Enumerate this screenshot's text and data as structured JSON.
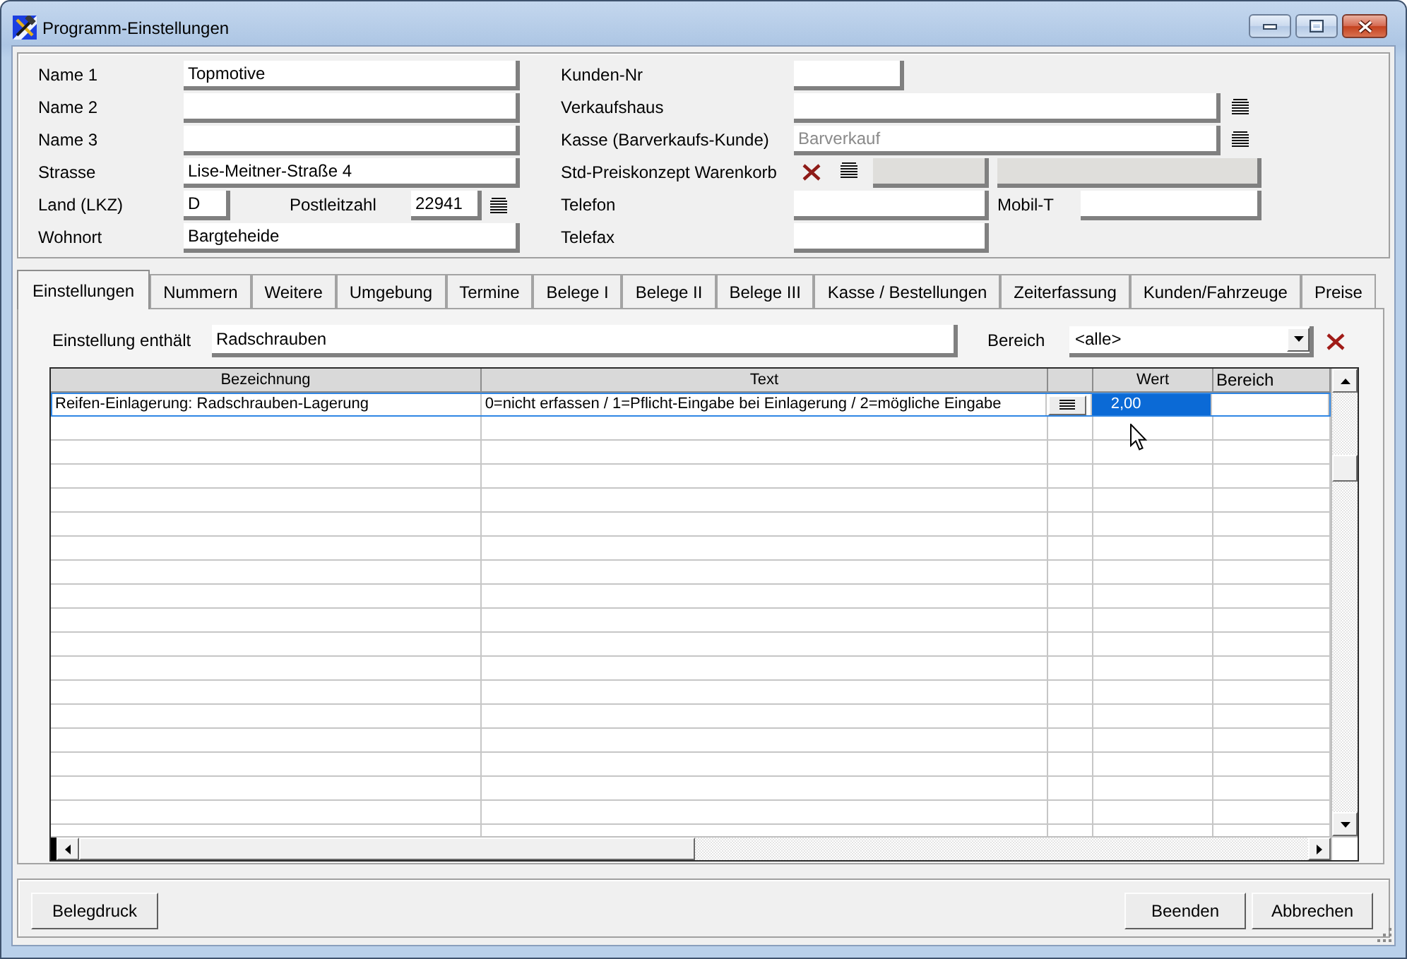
{
  "window": {
    "title": "Programm-Einstellungen"
  },
  "header_form": {
    "left_fields": [
      {
        "kind": "text",
        "label": "Name 1",
        "value": "Topmotive"
      },
      {
        "kind": "text",
        "label": "Name 2"
      },
      {
        "kind": "text",
        "label": "Name 3"
      },
      {
        "kind": "text",
        "label": "Strasse",
        "value": "Lise-Meitner-Straße 4"
      },
      {
        "kind": "country_zip",
        "label": "Land (LKZ)",
        "value": "D",
        "zip_label": "Postleitzahl",
        "zip_value": "22941"
      },
      {
        "kind": "text",
        "label": "Wohnort",
        "value": "Bargteheide"
      }
    ],
    "right_fields": [
      {
        "kind": "number",
        "label": "Kunden-Nr"
      },
      {
        "kind": "lookup",
        "label": "Verkaufshaus"
      },
      {
        "kind": "lookup",
        "label": "Kasse (Barverkaufs-Kunde)",
        "placeholder": "Barverkauf"
      },
      {
        "kind": "concept",
        "label": "Std-Preiskonzept Warenkorb",
        "disabled": true
      },
      {
        "kind": "phone",
        "label": "Telefon",
        "second_label": "Mobil-T"
      },
      {
        "kind": "text",
        "label": "Telefax"
      }
    ]
  },
  "tabs": [
    {
      "label": "Einstellungen",
      "selected": true
    },
    {
      "label": "Nummern",
      "selected": false
    },
    {
      "label": "Weitere",
      "selected": false
    },
    {
      "label": "Umgebung",
      "selected": false
    },
    {
      "label": "Termine",
      "selected": false
    },
    {
      "label": "Belege I",
      "selected": false
    },
    {
      "label": "Belege II",
      "selected": false
    },
    {
      "label": "Belege III",
      "selected": false
    },
    {
      "label": "Kasse / Bestellungen",
      "selected": false
    },
    {
      "label": "Zeiterfassung",
      "selected": false
    },
    {
      "label": "Kunden/Fahrzeuge",
      "selected": false
    },
    {
      "label": "Preise",
      "selected": false
    }
  ],
  "filter": {
    "label": "Einstellung enthält",
    "value": "Radschrauben"
  },
  "area_filter": {
    "label": "Bereich",
    "value": "<alle>"
  },
  "table": {
    "columns": [
      {
        "kind": "text",
        "label": "Bezeichnung"
      },
      {
        "kind": "text",
        "label": "Text"
      },
      {
        "kind": "button"
      },
      {
        "kind": "text",
        "label": "Wert"
      },
      {
        "kind": "area",
        "label": "Bereich"
      }
    ],
    "rows": [
      {
        "designation": "Reifen-Einlagerung: Radschrauben-Lagerung",
        "text": "0=nicht erfassen / 1=Pflicht-Eingabe bei Einlagerung / 2=mögliche Eingabe",
        "value": "2,00",
        "selected": true
      }
    ]
  },
  "footer": {
    "left_buttons": [
      "Belegdruck"
    ],
    "right_buttons": [
      "Beenden",
      "Abbrechen"
    ]
  }
}
